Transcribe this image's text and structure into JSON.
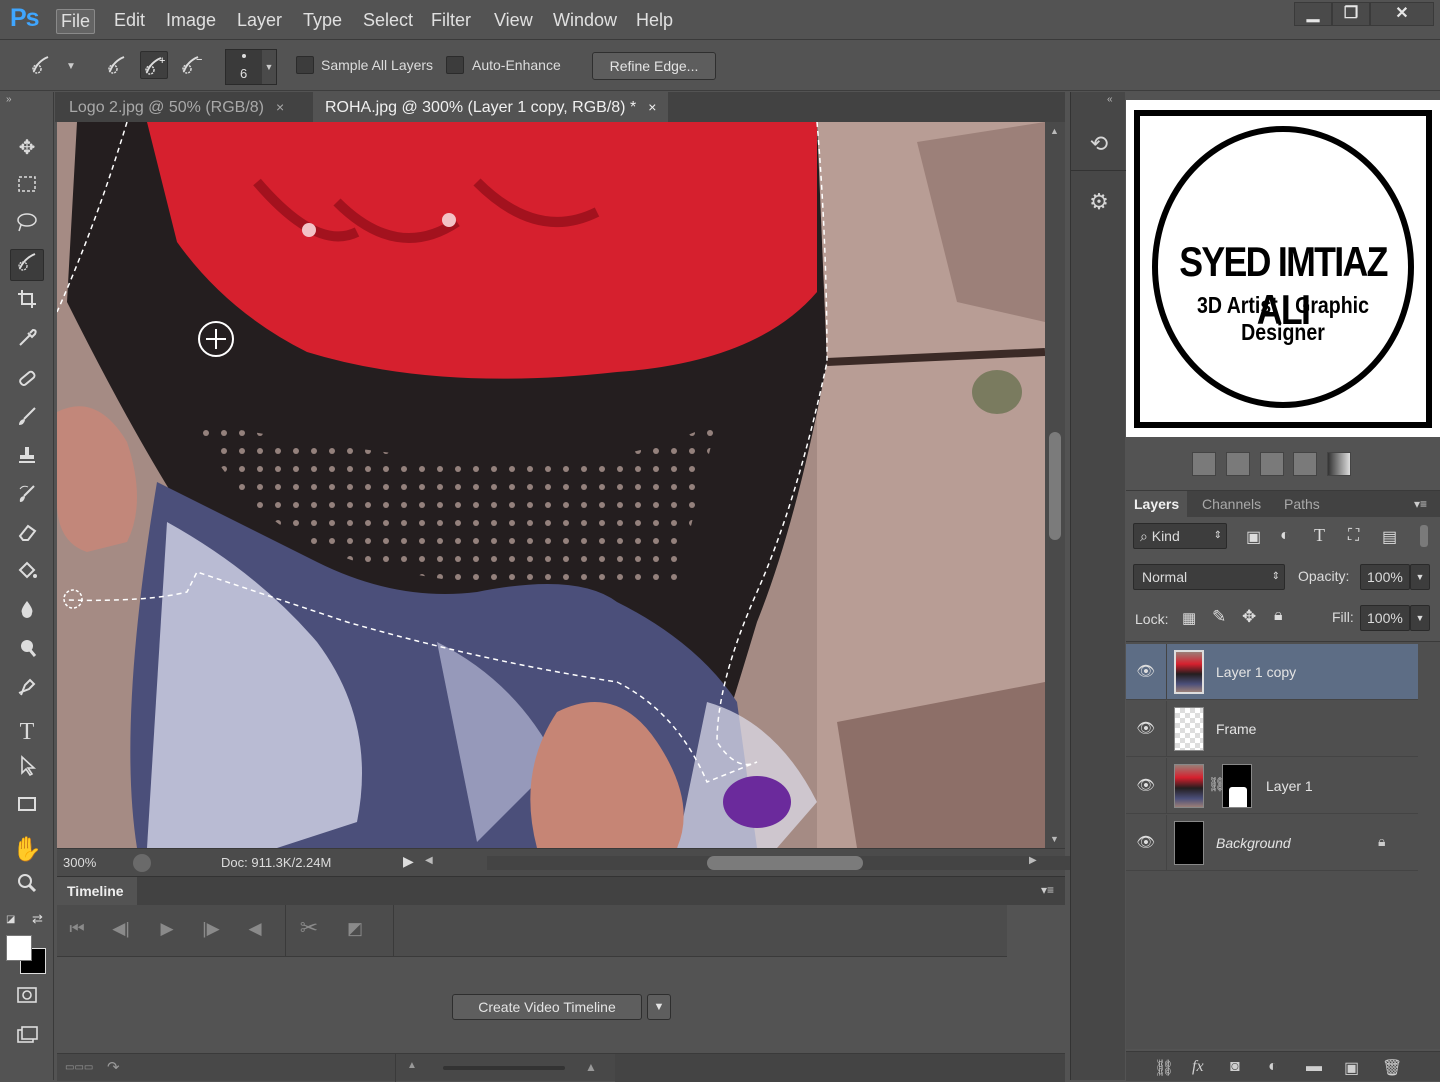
{
  "app": {
    "logo": "Ps"
  },
  "menu": [
    "File",
    "Edit",
    "Image",
    "Layer",
    "Type",
    "Select",
    "Filter",
    "View",
    "Window",
    "Help"
  ],
  "window_controls": {
    "minimize": "▁",
    "restore": "❐",
    "close": "✕"
  },
  "options": {
    "brush_size": "6",
    "sample_all_layers": "Sample All Layers",
    "auto_enhance": "Auto-Enhance",
    "refine_edge": "Refine Edge..."
  },
  "tabs": [
    {
      "label": "Logo 2.jpg @ 50% (RGB/8)",
      "close": "×"
    },
    {
      "label": "ROHA.jpg @ 300% (Layer 1 copy, RGB/8) *",
      "close": "×"
    }
  ],
  "status": {
    "zoom": "300%",
    "doc": "Doc: 911.3K/2.24M"
  },
  "timeline": {
    "tab": "Timeline",
    "create_button": "Create Video Timeline"
  },
  "watermark": {
    "name": "SYED IMTIAZ ALI",
    "subtitle": "3D Artist : Graphic Designer"
  },
  "layers_panel": {
    "tabs": [
      "Layers",
      "Channels",
      "Paths"
    ],
    "filter_kind": "Kind",
    "blend_mode": "Normal",
    "opacity_label": "Opacity:",
    "opacity": "100%",
    "lock_label": "Lock:",
    "fill_label": "Fill:",
    "fill": "100%",
    "layers": [
      {
        "name": "Layer 1 copy",
        "visible": true,
        "selected": true
      },
      {
        "name": "Frame",
        "visible": true,
        "selected": false
      },
      {
        "name": "Layer 1",
        "visible": true,
        "selected": false
      },
      {
        "name": "Background",
        "visible": true,
        "selected": false,
        "locked": true
      }
    ]
  },
  "colors": {
    "accent": "#3fa6ff",
    "selected_layer": "#5d6d85",
    "scarf": "#d6202e"
  }
}
